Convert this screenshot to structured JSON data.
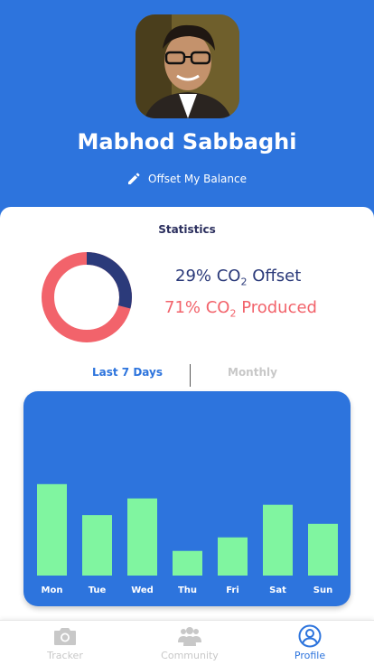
{
  "profile": {
    "name": "Mabhod Sabbaghi",
    "offset_link_label": "Offset My Balance"
  },
  "statistics": {
    "title": "Statistics",
    "offset_percent": 29,
    "produced_percent": 71,
    "offset_prefix": "29% CO",
    "offset_subscript": "2",
    "offset_suffix": " Offset",
    "produced_prefix": "71% CO",
    "produced_subscript": "2",
    "produced_suffix": " Produced",
    "offset_color": "#2b3a7a",
    "produced_color": "#f2636b"
  },
  "tabs": {
    "active": "Last 7 Days",
    "inactive": "Monthly"
  },
  "chart_data": {
    "type": "bar",
    "categories": [
      "Mon",
      "Tue",
      "Wed",
      "Thu",
      "Fri",
      "Sat",
      "Sun"
    ],
    "values": [
      115,
      76,
      97,
      31,
      48,
      89,
      65
    ],
    "ylim": [
      0,
      125
    ],
    "bar_color": "#80f5a0",
    "background_color": "#2d74dd",
    "grid": false
  },
  "tabbar": {
    "items": [
      {
        "label": "Tracker",
        "icon": "camera-icon",
        "active": false
      },
      {
        "label": "Community",
        "icon": "community-icon",
        "active": false
      },
      {
        "label": "Profile",
        "icon": "profile-icon",
        "active": true
      }
    ]
  },
  "colors": {
    "primary": "#2d74dd",
    "inactive": "#c8c8c8"
  }
}
